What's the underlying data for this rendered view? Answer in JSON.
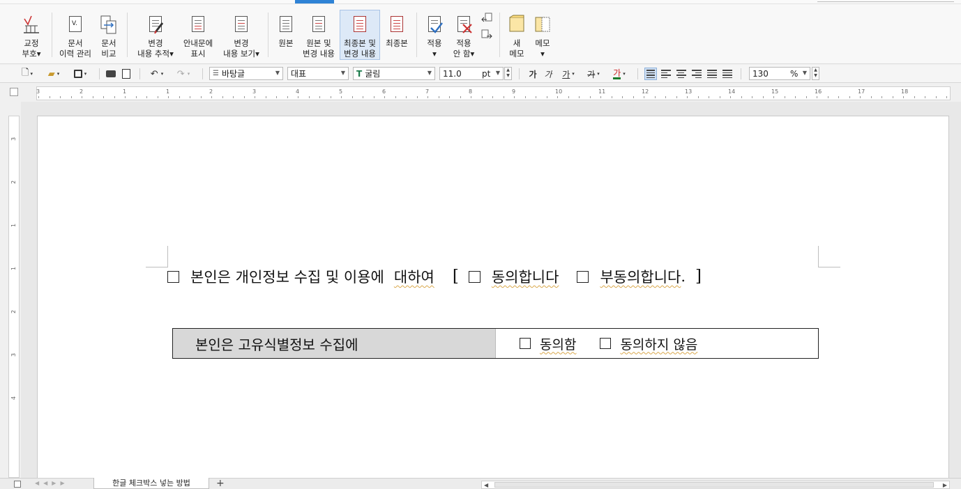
{
  "ribbon": {
    "groups": [
      {
        "id": "proofread",
        "line1": "교정",
        "line2": "부호",
        "icon": "proofread-mark-icon"
      },
      {
        "id": "history",
        "line1": "문서",
        "line2": "이력 관리",
        "icon": "document-history-icon"
      },
      {
        "id": "compare",
        "line1": "문서",
        "line2": "비교",
        "icon": "document-compare-icon"
      },
      {
        "id": "track",
        "line1": "변경",
        "line2": "내용 추적",
        "icon": "track-changes-icon"
      },
      {
        "id": "show_guide",
        "line1": "안내문에",
        "line2": "표시",
        "icon": "show-in-guide-icon"
      },
      {
        "id": "view_changes",
        "line1": "변경",
        "line2": "내용 보기",
        "icon": "view-changes-icon"
      },
      {
        "id": "original",
        "line1": "원본",
        "line2": "",
        "icon": "original-doc-icon"
      },
      {
        "id": "original_changes",
        "line1": "원본 및",
        "line2": "변경 내용",
        "icon": "original-and-changes-icon"
      },
      {
        "id": "final_changes",
        "line1": "최종본 및",
        "line2": "변경 내용",
        "icon": "final-and-changes-icon"
      },
      {
        "id": "final",
        "line1": "최종본",
        "line2": "",
        "icon": "final-doc-icon"
      },
      {
        "id": "apply",
        "line1": "적용",
        "line2": "",
        "icon": "apply-change-icon"
      },
      {
        "id": "not_apply",
        "line1": "적용",
        "line2": "안 함",
        "icon": "reject-change-icon"
      },
      {
        "id": "new_memo",
        "line1": "새",
        "line2": "메모",
        "icon": "new-memo-icon"
      },
      {
        "id": "memo",
        "line1": "메모",
        "line2": "",
        "icon": "memo-icon"
      }
    ]
  },
  "format_toolbar": {
    "font_lang": "바탕글",
    "style": "대표",
    "font": "굴림",
    "font_size": "11.0",
    "font_unit": "pt",
    "zoom": "130",
    "zoom_unit": "%",
    "bold": "가",
    "italic": "가",
    "underline": "가",
    "strike": "가",
    "color": "가"
  },
  "ruler": {
    "h_ticks": [
      "3",
      "2",
      "1",
      "1",
      "2",
      "3",
      "4",
      "5",
      "6",
      "7",
      "8",
      "9",
      "10",
      "11",
      "12",
      "13",
      "14",
      "15",
      "16",
      "17",
      "18"
    ],
    "v_ticks": [
      "3",
      "2",
      "1",
      "1",
      "2",
      "3",
      "4"
    ]
  },
  "document": {
    "line1": {
      "text": "본인은 개인정보 수집 및 이용에",
      "word": "대하여",
      "bracket_open": "[",
      "option1": "동의합니다",
      "option2": "부동의합니다",
      "option2_end": ".",
      "bracket_close": "]"
    },
    "table": {
      "label": "본인은 고유식별정보 수집에",
      "option1": "동의함",
      "option2": "동의하지 않음"
    }
  },
  "bottom": {
    "sheet_tab": "한글 체크박스 넣는 방법",
    "add_tab": "+"
  }
}
